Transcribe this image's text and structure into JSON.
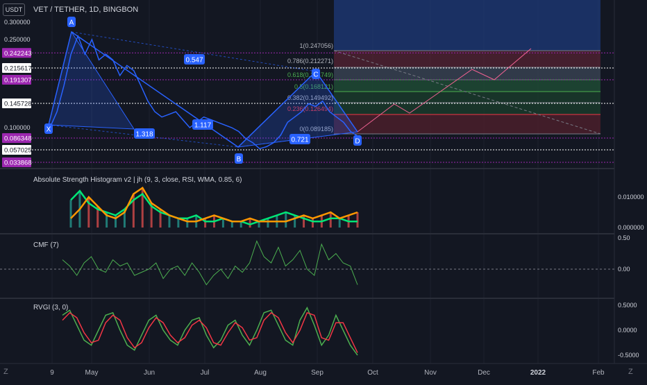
{
  "header": {
    "currency": "USDT",
    "symbol_line": "VET / TETHER, 1D, BINGBON"
  },
  "panes": {
    "asi_title": "Absolute Strength Histogram v2 | jh (9, 3, close, RSI, WMA, 0.85, 6)",
    "cmf_title": "CMF (7)",
    "rvgi_title": "RVGI (3, 0)"
  },
  "price_axis": {
    "ticks": [
      "0.300000",
      "0.250000",
      "0.100000"
    ],
    "badges": [
      {
        "text": "0.242243",
        "color": "#9c27b0",
        "price": 0.242243
      },
      {
        "text": "0.215617",
        "color": "#ffffff",
        "price": 0.215617
      },
      {
        "text": "0.191307",
        "color": "#9c27b0",
        "price": 0.191307
      },
      {
        "text": "0.145728",
        "color": "#ffffff",
        "price": 0.145728
      },
      {
        "text": "0.086348",
        "color": "#9c27b0",
        "price": 0.086348
      },
      {
        "text": "0.057025",
        "color": "#ffffff",
        "price": 0.057025
      },
      {
        "text": "0.033868",
        "color": "#9c27b0",
        "price": 0.033868
      }
    ]
  },
  "pattern": {
    "points": [
      "X",
      "A",
      "B",
      "C",
      "D"
    ],
    "ratios": [
      "0.547",
      "1.318",
      "1.117",
      "0.721"
    ]
  },
  "fib_levels": [
    {
      "label": "1(0.247056)",
      "color": "#b2b5be"
    },
    {
      "label": "0.786(0.212271)",
      "color": "#b2b5be"
    },
    {
      "label": "0.618(0.184749)",
      "color": "#4caf50"
    },
    {
      "label": "0.5(0.168121)",
      "color": "#4caf50"
    },
    {
      "label": "0.382(0.149492)",
      "color": "#b2b5be"
    },
    {
      "label": "0.236(0.126494)",
      "color": "#f23645"
    },
    {
      "label": "0(0.089185)",
      "color": "#b2b5be"
    }
  ],
  "indicator_axes": {
    "asi": [
      "0.010000",
      "0.000000"
    ],
    "cmf": [
      "0.50",
      "0.00"
    ],
    "rvgi": [
      "0.5000",
      "0.0000",
      "-0.5000"
    ]
  },
  "time_axis": [
    "9",
    "May",
    "Jun",
    "Jul",
    "Aug",
    "Sep",
    "Oct",
    "Nov",
    "Dec",
    "2022",
    "Feb"
  ],
  "bottom_bar": {
    "left": "Z",
    "right": "Z"
  },
  "colors": {
    "background": "#131722",
    "pattern_blue": "#2962ff",
    "price_line": "#2962ff",
    "asi_green": "#00e676",
    "asi_orange": "#ff9800",
    "cmf_green": "#4caf50",
    "rvgi_green": "#4caf50",
    "rvgi_red": "#f23645",
    "projection_pink": "#f06292"
  },
  "chart_data": [
    {
      "type": "line",
      "title": "VET / TETHER, 1D, BINGBON",
      "ylabel": "",
      "ylim": [
        0.03,
        0.3
      ],
      "series": [
        {
          "values": [
            0.1,
            0.13,
            0.18,
            0.24,
            0.26,
            0.24,
            0.25,
            0.23,
            0.24,
            0.23,
            0.2,
            0.22,
            0.21,
            0.18,
            0.15,
            0.13,
            0.12,
            0.125,
            0.13,
            0.115,
            0.1,
            0.11,
            0.12,
            0.115,
            0.11,
            0.105,
            0.1,
            0.095,
            0.085,
            0.075,
            0.06,
            0.065,
            0.075,
            0.09,
            0.11,
            0.12,
            0.13,
            0.145,
            0.14,
            0.15,
            0.13,
            0.12,
            0.11,
            0.095,
            0.089
          ]
        }
      ]
    },
    {
      "type": "bar",
      "title": "Absolute Strength Histogram v2 | jh (9, 3, close, RSI, WMA, 0.85, 6)",
      "ylim": [
        0,
        0.015
      ],
      "series": [
        {
          "name": "",
          "values": [
            0.009,
            0.012,
            0.008,
            0.006,
            0.005,
            0.004,
            0.006,
            0.009,
            0.011,
            0.007,
            0.005,
            0.004,
            0.003,
            0.003,
            0.004,
            0.002,
            0.002,
            0.003,
            0.002,
            0.002,
            0.001,
            0.002,
            0.003,
            0.004,
            0.005,
            0.004,
            0.003,
            0.002,
            0.002,
            0.003,
            0.003,
            0.002,
            0.002
          ]
        },
        {
          "name": "",
          "values": [
            0.003,
            0.006,
            0.01,
            0.007,
            0.004,
            0.003,
            0.005,
            0.011,
            0.013,
            0.008,
            0.006,
            0.004,
            0.003,
            0.002,
            0.002,
            0.003,
            0.004,
            0.003,
            0.002,
            0.002,
            0.003,
            0.002,
            0.002,
            0.002,
            0.002,
            0.003,
            0.004,
            0.003,
            0.004,
            0.005,
            0.003,
            0.004,
            0.005
          ]
        }
      ]
    },
    {
      "type": "line",
      "title": "CMF (7)",
      "ylim": [
        -0.4,
        0.5
      ],
      "series": [
        {
          "name": "",
          "values": [
            0.15,
            0.05,
            -0.1,
            0.1,
            0.2,
            0.0,
            -0.05,
            0.15,
            0.05,
            0.1,
            -0.1,
            -0.05,
            0.0,
            0.1,
            -0.15,
            0.0,
            0.05,
            -0.1,
            0.1,
            -0.05,
            -0.25,
            -0.1,
            0.0,
            -0.15,
            0.05,
            -0.05,
            0.1,
            0.45,
            0.2,
            0.1,
            0.35,
            0.05,
            0.15,
            0.3,
            0.0,
            -0.1,
            0.4,
            0.15,
            0.25,
            0.1,
            0.05,
            -0.25
          ]
        }
      ]
    },
    {
      "type": "line",
      "title": "RVGI (3, 0)",
      "ylim": [
        -0.6,
        0.6
      ],
      "series": [
        {
          "name": "",
          "values": [
            0.3,
            0.4,
            0.1,
            -0.2,
            -0.3,
            0.0,
            0.3,
            0.35,
            0.0,
            -0.3,
            -0.4,
            -0.1,
            0.2,
            0.3,
            0.0,
            -0.2,
            -0.3,
            0.0,
            0.2,
            0.25,
            -0.1,
            -0.35,
            -0.2,
            0.1,
            0.2,
            -0.1,
            -0.3,
            0.0,
            0.35,
            0.4,
            0.1,
            -0.2,
            -0.3,
            0.2,
            0.45,
            0.1,
            -0.3,
            -0.1,
            0.3,
            0.0,
            -0.3,
            -0.5
          ]
        },
        {
          "name": "",
          "values": [
            0.2,
            0.35,
            0.25,
            -0.05,
            -0.25,
            -0.2,
            0.15,
            0.3,
            0.2,
            -0.15,
            -0.35,
            -0.25,
            0.05,
            0.25,
            0.15,
            -0.1,
            -0.25,
            -0.15,
            0.1,
            0.2,
            0.05,
            -0.25,
            -0.3,
            -0.05,
            0.15,
            0.05,
            -0.2,
            -0.15,
            0.2,
            0.35,
            0.25,
            -0.05,
            -0.25,
            0.0,
            0.35,
            0.3,
            -0.15,
            -0.2,
            0.15,
            0.15,
            -0.15,
            -0.45
          ]
        }
      ]
    }
  ]
}
